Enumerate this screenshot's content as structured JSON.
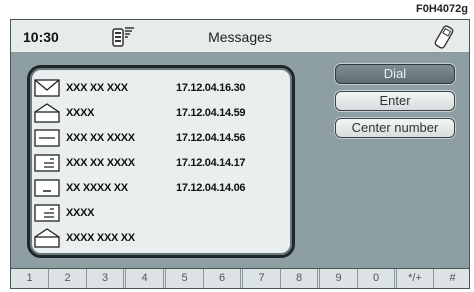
{
  "figure_code": "F0H4072g",
  "topbar": {
    "time": "10:30",
    "title": "Messages",
    "signal_icon": "phone-signal-icon",
    "phone_icon": "mobile-phone-icon"
  },
  "messages": [
    {
      "icon": "envelope-closed-icon",
      "sender": "XXX XX XXX",
      "date": "17.12.04.16.30"
    },
    {
      "icon": "envelope-open-icon",
      "sender": "XXXX",
      "date": "17.12.04.14.59"
    },
    {
      "icon": "message-plain-icon",
      "sender": "XXX XX  XXXX",
      "date": "17.12.04.14.56"
    },
    {
      "icon": "message-text-icon",
      "sender": "XXX XX XXXX",
      "date": "17.12.04.14.17"
    },
    {
      "icon": "message-sent-icon",
      "sender": "XX XXXX XX",
      "date": "17.12.04.14.06"
    },
    {
      "icon": "message-text-icon",
      "sender": "XXXX",
      "date": ""
    },
    {
      "icon": "envelope-open-icon",
      "sender": "XXXX XXX XX",
      "date": ""
    }
  ],
  "buttons": {
    "dial": "Dial",
    "enter": "Enter",
    "center_number": "Center number"
  },
  "keypad": [
    "1",
    "2",
    "3",
    "4",
    "5",
    "6",
    "7",
    "8",
    "9",
    "0",
    "*/+",
    "#"
  ]
}
